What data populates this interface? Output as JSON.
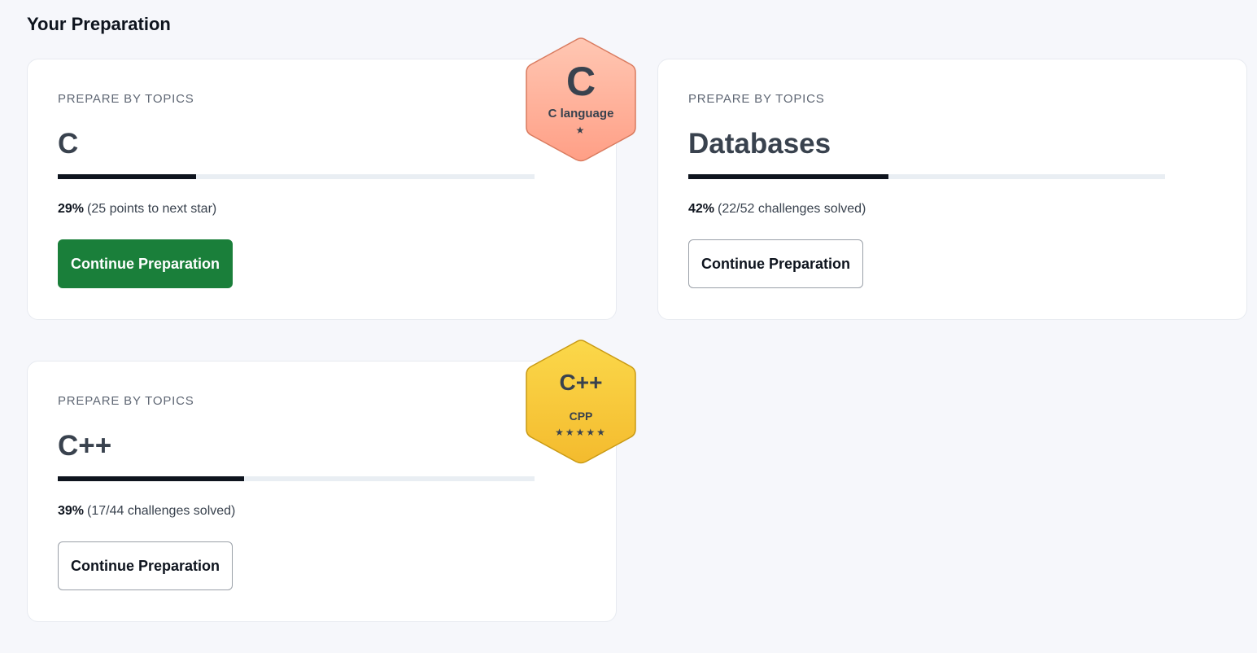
{
  "page": {
    "title": "Your Preparation"
  },
  "cards": [
    {
      "eyebrow": "PREPARE BY TOPICS",
      "topic": "C",
      "progress_percent": 29,
      "stat_percent": "29%",
      "stat_detail": "(25 points to next star)",
      "button_label": "Continue Preparation",
      "button_style": "primary"
    },
    {
      "eyebrow": "PREPARE BY TOPICS",
      "topic": "Databases",
      "progress_percent": 42,
      "stat_percent": "42%",
      "stat_detail": "(22/52 challenges solved)",
      "button_label": "Continue Preparation",
      "button_style": "outline"
    },
    {
      "eyebrow": "PREPARE BY TOPICS",
      "topic": "C++",
      "progress_percent": 39,
      "stat_percent": "39%",
      "stat_detail": "(17/44 challenges solved)",
      "button_label": "Continue Preparation",
      "button_style": "outline"
    }
  ],
  "badges": [
    {
      "letter": "C",
      "name": "C language",
      "stars": "★",
      "star_count": 1,
      "colors": {
        "fill_top": "#ffc7b3",
        "fill_bottom": "#ff9f86",
        "stroke": "#d97b5f"
      }
    },
    {
      "letter": "C++",
      "name": "CPP",
      "stars": "★★★★★",
      "star_count": 5,
      "colors": {
        "fill_top": "#fbd84a",
        "fill_bottom": "#f4bb2e",
        "stroke": "#c99a14"
      }
    }
  ],
  "colors": {
    "background": "#f6f7fb",
    "primary_button": "#1a7f3a",
    "progress_fill": "#0e141e",
    "progress_track": "#e9eef3"
  }
}
